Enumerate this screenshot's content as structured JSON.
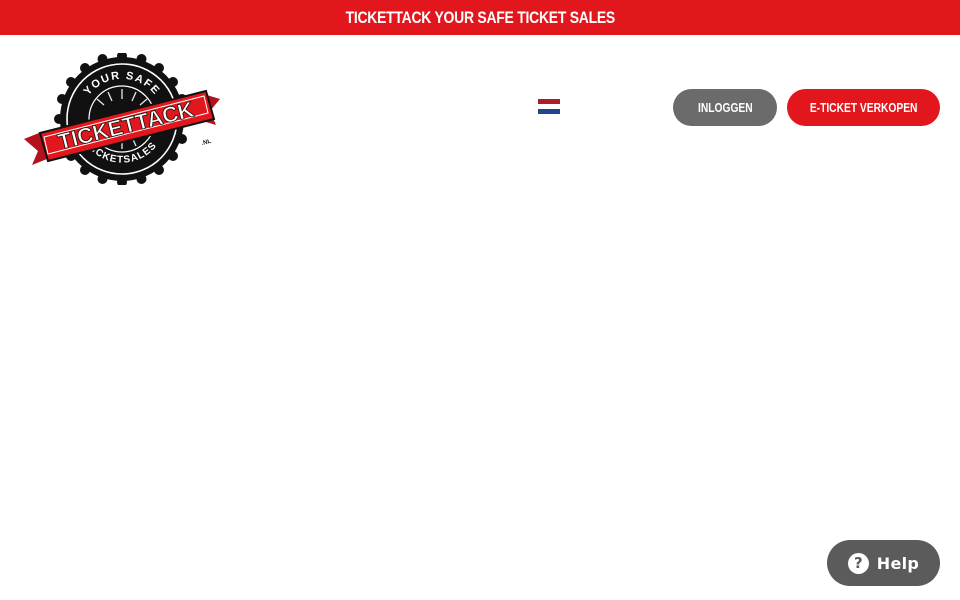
{
  "banner": {
    "text": "TICKETTACK YOUR SAFE TICKET SALES",
    "color": "#e2171d"
  },
  "logo": {
    "top_text": "YOUR SAFE",
    "ribbon_text": "TICKETTACK",
    "suffix": ".NL",
    "bottom_text": "TICKETSALES"
  },
  "header": {
    "language_flag": "netherlands-flag-icon",
    "login_label": "INLOGGEN",
    "sell_label": "E-TICKET VERKOPEN"
  },
  "help": {
    "label": "Help",
    "icon": "?"
  },
  "colors": {
    "brand_red": "#e2171d",
    "login_gray": "#6b6b6b",
    "help_gray": "#5b5b5b"
  }
}
